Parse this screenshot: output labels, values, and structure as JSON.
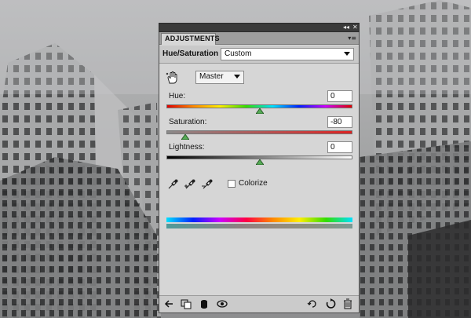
{
  "panel": {
    "tab_label": "ADJUSTMENTS",
    "adjustment_title": "Hue/Saturation",
    "preset_value": "Custom",
    "channel_value": "Master"
  },
  "sliders": [
    {
      "label": "Hue:",
      "value": "0",
      "level": 0.5,
      "track": "hue-spectrum"
    },
    {
      "label": "Saturation:",
      "value": "-80",
      "level": 0.1,
      "track": "gray-to-red"
    },
    {
      "label": "Lightness:",
      "value": "0",
      "level": 0.5,
      "track": "black-to-white"
    }
  ],
  "colorize": {
    "label": "Colorize",
    "checked": false
  },
  "icons": {
    "top_bar": [
      "collapse-icon",
      "close-icon"
    ],
    "panel_menu": "panel-menu-icon",
    "tool": "on-image-adjust-hand-icon",
    "eyedroppers": [
      "eyedropper-icon",
      "eyedropper-add-icon",
      "eyedropper-subtract-icon"
    ],
    "footer_left": [
      "back-arrow-icon",
      "clip-to-layer-icon",
      "visibility-icon",
      "view-previous-state-icon"
    ],
    "footer_right": [
      "reset-icon",
      "refresh-icon",
      "delete-icon"
    ]
  },
  "colors": {
    "panel_bg": "#d6d6d6",
    "saturation_track_end": "#dd2222"
  }
}
